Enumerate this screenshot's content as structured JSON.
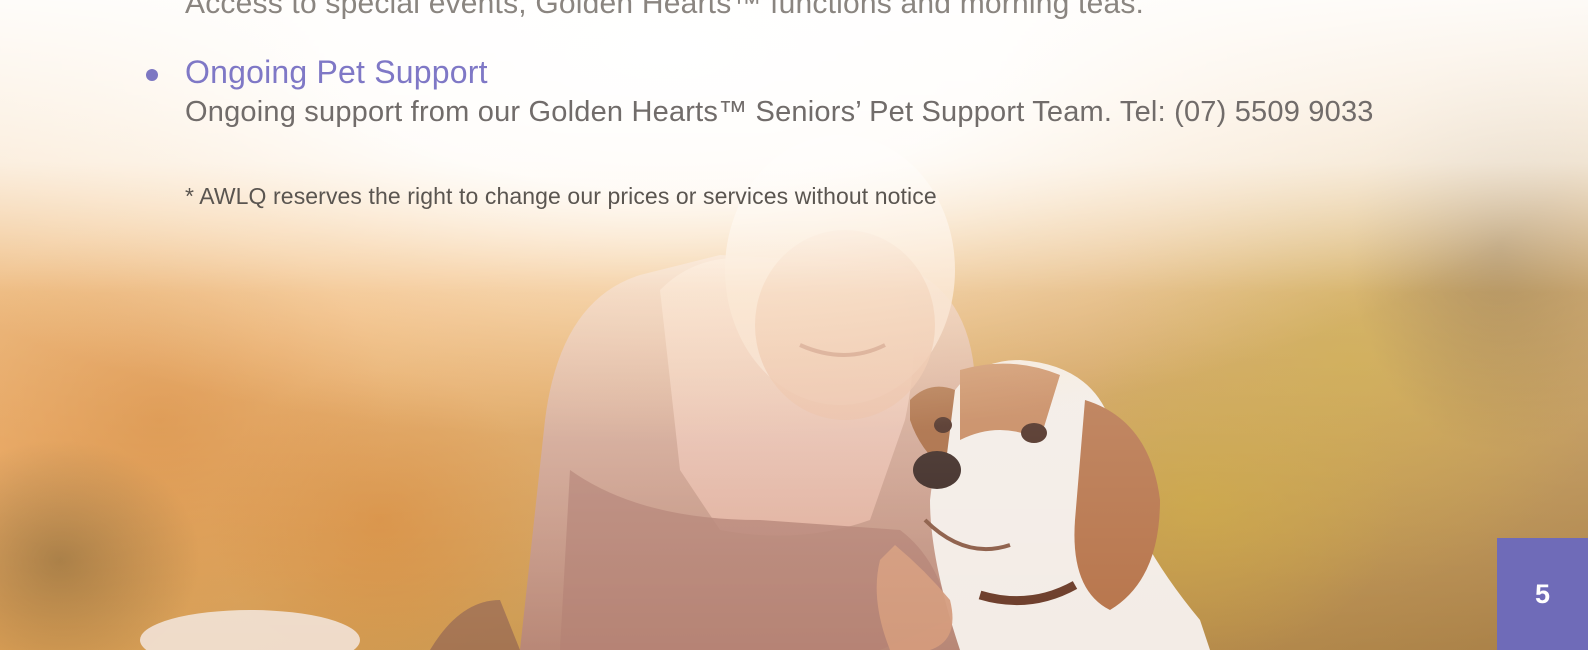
{
  "previous_item": {
    "text": "Access to special events, Golden Hearts™ functions and morning teas."
  },
  "item": {
    "heading": "Ongoing Pet Support",
    "description": "Ongoing support from our Golden Hearts™ Seniors’ Pet Support Team. Tel:  (07) 5509 9033"
  },
  "disclaimer": "* AWLQ reserves the right to change our prices or services without notice",
  "page_number": "5",
  "photo": {
    "subject": "senior-woman-hugging-beagle",
    "icon": "photo-image"
  },
  "colors": {
    "heading": "#7f78c6",
    "bullet": "#7d77c2",
    "body_text": "#716c6a",
    "badge": "#6f6bb8"
  }
}
